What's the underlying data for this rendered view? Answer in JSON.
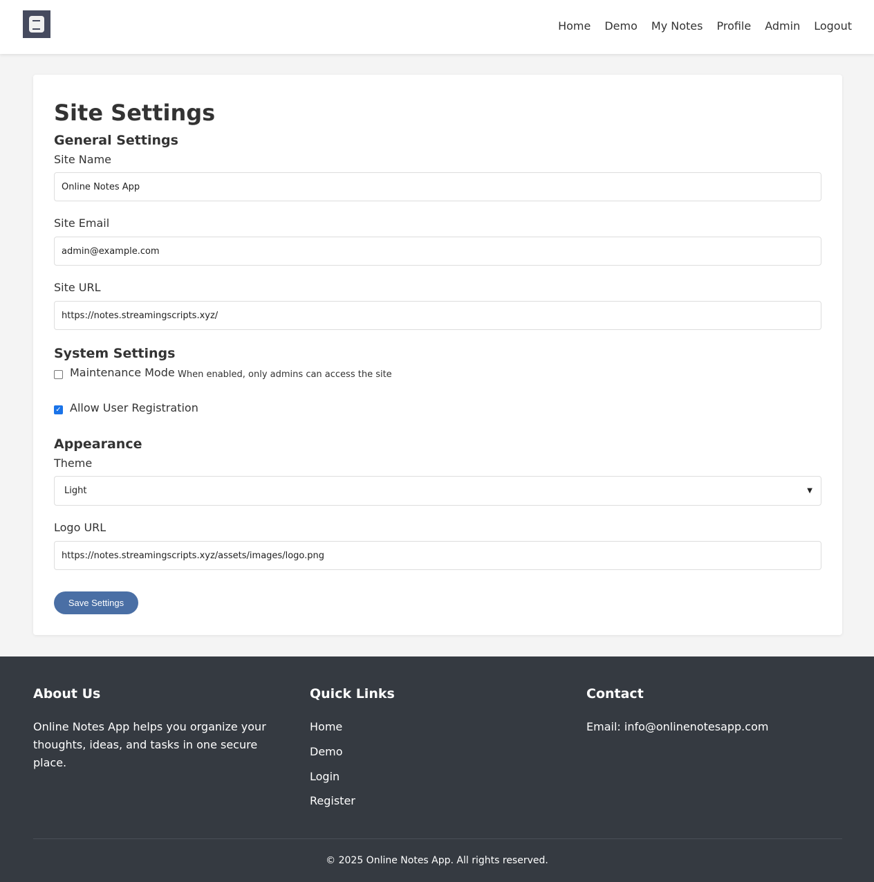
{
  "nav": [
    "Home",
    "Demo",
    "My Notes",
    "Profile",
    "Admin",
    "Logout"
  ],
  "page_title": "Site Settings",
  "general": {
    "heading": "General Settings",
    "site_name_label": "Site Name",
    "site_name": "Online Notes App",
    "site_email_label": "Site Email",
    "site_email": "admin@example.com",
    "site_url_label": "Site URL",
    "site_url": "https://notes.streamingscripts.xyz/"
  },
  "system": {
    "heading": "System Settings",
    "maintenance_label": "Maintenance Mode",
    "maintenance_hint": "When enabled, only admins can access the site",
    "maintenance_checked": false,
    "registration_label": "Allow User Registration",
    "registration_checked": true
  },
  "appearance": {
    "heading": "Appearance",
    "theme_label": "Theme",
    "theme": "Light",
    "logo_url_label": "Logo URL",
    "logo_url": "https://notes.streamingscripts.xyz/assets/images/logo.png"
  },
  "save_label": "Save Settings",
  "footer": {
    "about_heading": "About Us",
    "about_text": "Online Notes App helps you organize your thoughts, ideas, and tasks in one secure place.",
    "links_heading": "Quick Links",
    "links": [
      "Home",
      "Demo",
      "Login",
      "Register"
    ],
    "contact_heading": "Contact",
    "contact_email": "Email: info@onlinenotesapp.com",
    "copyright": "© 2025 Online Notes App. All rights reserved."
  }
}
